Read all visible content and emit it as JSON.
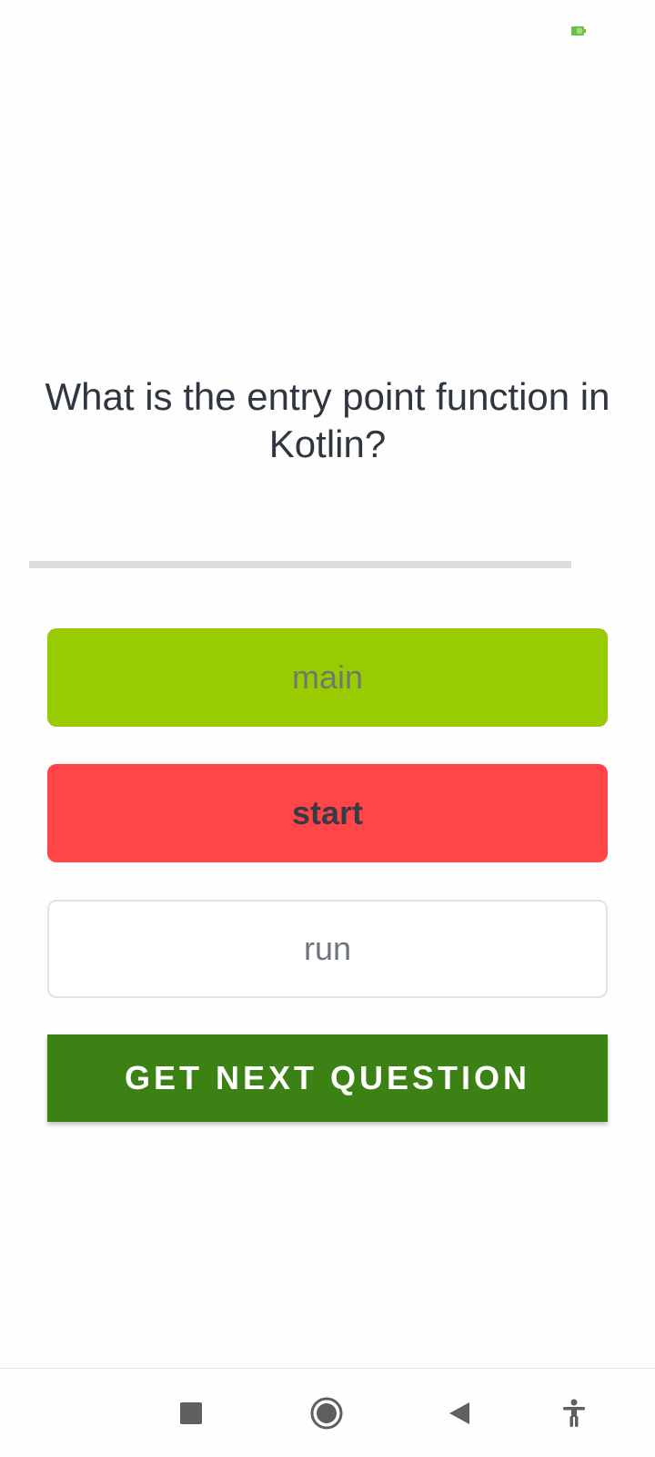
{
  "status_bar": {
    "battery_icon": "battery-icon",
    "battery_color": "#6cc04a"
  },
  "quiz": {
    "question": "What is the entry point function in Kotlin?",
    "progress": 0,
    "answers": [
      {
        "label": "main",
        "state": "correct",
        "color": "#99cc00"
      },
      {
        "label": "start",
        "state": "wrong-selected",
        "color": "#ff4548"
      },
      {
        "label": "run",
        "state": "neutral",
        "color": "#ffffff"
      }
    ],
    "next_button_label": "GET NEXT QUESTION",
    "next_button_color": "#3b8114"
  },
  "navigation": {
    "recents_icon": "square-icon",
    "home_icon": "circle-icon",
    "back_icon": "triangle-back-icon",
    "accessibility_icon": "accessibility-icon"
  }
}
